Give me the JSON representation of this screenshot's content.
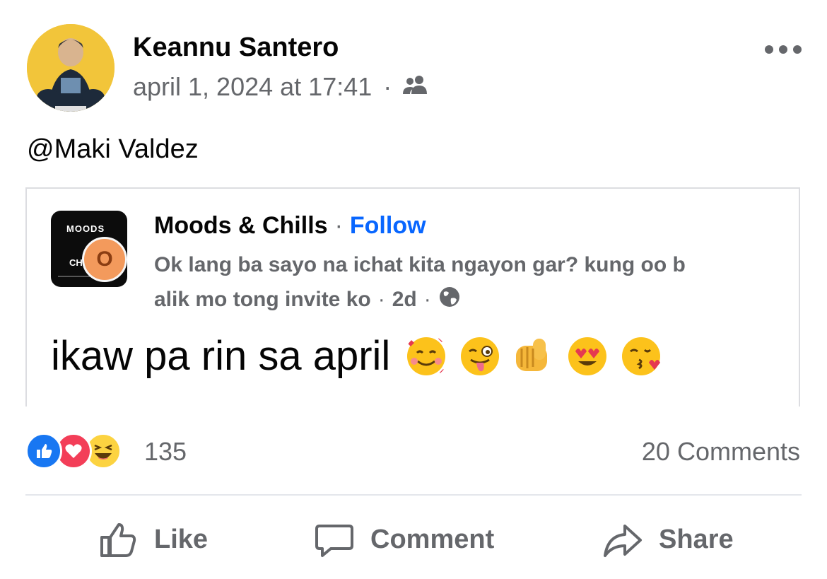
{
  "post": {
    "author": "Keannu Santero",
    "timestamp": "april 1, 2024 at 17:41",
    "audience_icon": "friends-icon",
    "caption": "@Maki Valdez"
  },
  "shared": {
    "page_logo_text_top": "MOODS",
    "page_logo_text_bottom": "CH",
    "notification_letter": "O",
    "page_name": "Moods & Chills",
    "follow_label": "Follow",
    "subtitle_line1": "Ok lang ba sayo na ichat kita ngayon gar? kung oo b",
    "subtitle_line2": "alik mo tong invite ko",
    "age": "2d",
    "privacy_icon": "globe-icon",
    "content_text": "ikaw pa rin sa april",
    "emojis": [
      "smiling-face-with-hearts",
      "winking-face-with-tongue",
      "fist-pointing-forward",
      "heart-eyes-face",
      "face-blowing-kiss"
    ]
  },
  "reactions": {
    "icons": [
      "like-reaction-icon",
      "love-reaction-icon",
      "haha-reaction-icon"
    ],
    "count": "135",
    "comments": "20 Comments"
  },
  "actions": {
    "like": "Like",
    "comment": "Comment",
    "share": "Share"
  },
  "colors": {
    "accent_blue": "#0866ff",
    "muted_text": "#65676b",
    "divider": "#e4e6eb",
    "like_blue": "#1877f2",
    "love_red": "#f33e58",
    "haha_yellow": "#fcd341"
  }
}
